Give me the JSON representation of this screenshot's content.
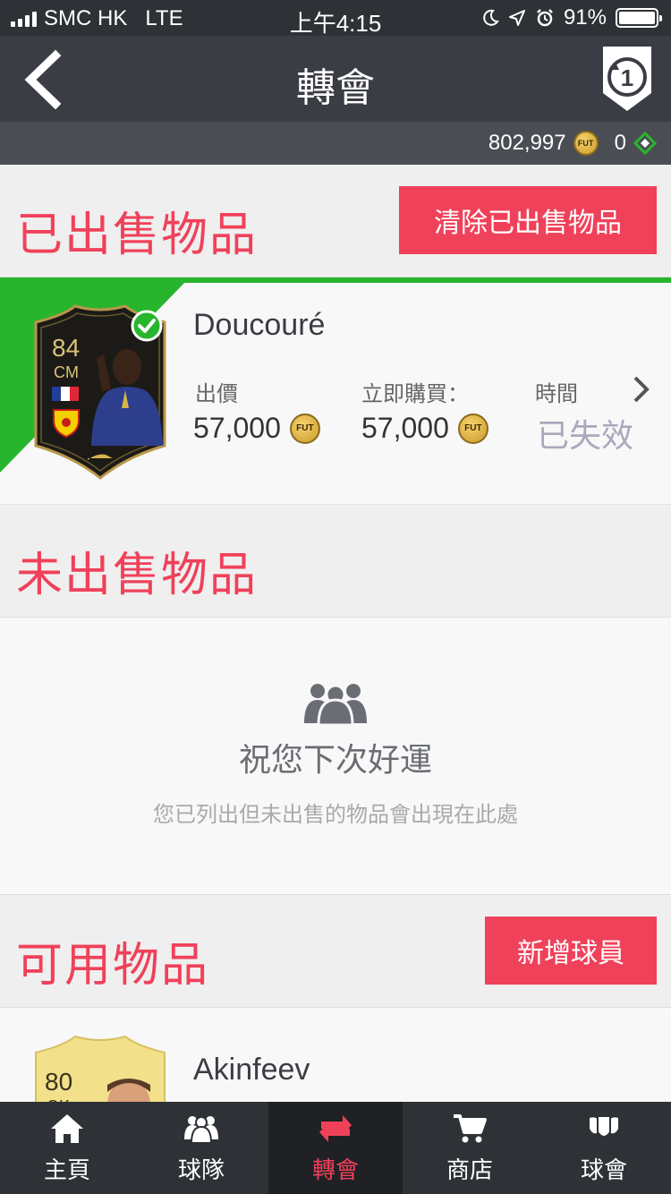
{
  "status_bar": {
    "carrier": "SMC HK",
    "network": "LTE",
    "time": "上午4:15",
    "battery": "91%"
  },
  "nav": {
    "title": "轉會",
    "season_number": "1"
  },
  "wallet": {
    "coins": "802,997",
    "coin_label": "FUT",
    "points": "0"
  },
  "sold_section": {
    "title": "已出售物品",
    "clear_button": "清除已出售物品",
    "item": {
      "name": "Doucouré",
      "rating": "84",
      "position": "CM",
      "bid_label": "出價",
      "bid_value": "57,000",
      "buy_now_label": "立即購買：",
      "buy_now_value": "57,000",
      "time_label": "時間",
      "time_value": "已失效"
    }
  },
  "unsold_section": {
    "title": "未出售物品",
    "empty_title": "祝您下次好運",
    "empty_desc": "您已列出但未出售的物品會出現在此處"
  },
  "available_section": {
    "title": "可用物品",
    "add_button": "新增球員",
    "item": {
      "name": "Akinfeev",
      "rating": "80",
      "position": "GK"
    }
  },
  "tabs": [
    {
      "label": "主頁",
      "icon": "home-icon"
    },
    {
      "label": "球隊",
      "icon": "squad-icon"
    },
    {
      "label": "轉會",
      "icon": "transfer-icon"
    },
    {
      "label": "商店",
      "icon": "cart-icon"
    },
    {
      "label": "球會",
      "icon": "club-icon"
    }
  ],
  "colors": {
    "accent": "#f0415a",
    "sold_green": "#28b52e",
    "header_dark": "#3a3d43"
  }
}
